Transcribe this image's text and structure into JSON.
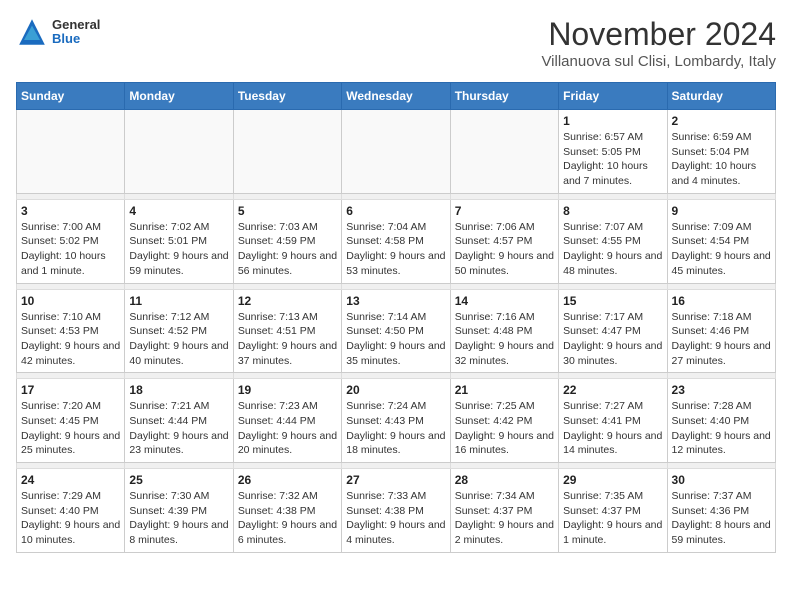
{
  "header": {
    "logo_general": "General",
    "logo_blue": "Blue",
    "month_title": "November 2024",
    "location": "Villanuova sul Clisi, Lombardy, Italy"
  },
  "days_of_week": [
    "Sunday",
    "Monday",
    "Tuesday",
    "Wednesday",
    "Thursday",
    "Friday",
    "Saturday"
  ],
  "weeks": [
    [
      {
        "day": "",
        "info": ""
      },
      {
        "day": "",
        "info": ""
      },
      {
        "day": "",
        "info": ""
      },
      {
        "day": "",
        "info": ""
      },
      {
        "day": "",
        "info": ""
      },
      {
        "day": "1",
        "info": "Sunrise: 6:57 AM\nSunset: 5:05 PM\nDaylight: 10 hours and 7 minutes."
      },
      {
        "day": "2",
        "info": "Sunrise: 6:59 AM\nSunset: 5:04 PM\nDaylight: 10 hours and 4 minutes."
      }
    ],
    [
      {
        "day": "3",
        "info": "Sunrise: 7:00 AM\nSunset: 5:02 PM\nDaylight: 10 hours and 1 minute."
      },
      {
        "day": "4",
        "info": "Sunrise: 7:02 AM\nSunset: 5:01 PM\nDaylight: 9 hours and 59 minutes."
      },
      {
        "day": "5",
        "info": "Sunrise: 7:03 AM\nSunset: 4:59 PM\nDaylight: 9 hours and 56 minutes."
      },
      {
        "day": "6",
        "info": "Sunrise: 7:04 AM\nSunset: 4:58 PM\nDaylight: 9 hours and 53 minutes."
      },
      {
        "day": "7",
        "info": "Sunrise: 7:06 AM\nSunset: 4:57 PM\nDaylight: 9 hours and 50 minutes."
      },
      {
        "day": "8",
        "info": "Sunrise: 7:07 AM\nSunset: 4:55 PM\nDaylight: 9 hours and 48 minutes."
      },
      {
        "day": "9",
        "info": "Sunrise: 7:09 AM\nSunset: 4:54 PM\nDaylight: 9 hours and 45 minutes."
      }
    ],
    [
      {
        "day": "10",
        "info": "Sunrise: 7:10 AM\nSunset: 4:53 PM\nDaylight: 9 hours and 42 minutes."
      },
      {
        "day": "11",
        "info": "Sunrise: 7:12 AM\nSunset: 4:52 PM\nDaylight: 9 hours and 40 minutes."
      },
      {
        "day": "12",
        "info": "Sunrise: 7:13 AM\nSunset: 4:51 PM\nDaylight: 9 hours and 37 minutes."
      },
      {
        "day": "13",
        "info": "Sunrise: 7:14 AM\nSunset: 4:50 PM\nDaylight: 9 hours and 35 minutes."
      },
      {
        "day": "14",
        "info": "Sunrise: 7:16 AM\nSunset: 4:48 PM\nDaylight: 9 hours and 32 minutes."
      },
      {
        "day": "15",
        "info": "Sunrise: 7:17 AM\nSunset: 4:47 PM\nDaylight: 9 hours and 30 minutes."
      },
      {
        "day": "16",
        "info": "Sunrise: 7:18 AM\nSunset: 4:46 PM\nDaylight: 9 hours and 27 minutes."
      }
    ],
    [
      {
        "day": "17",
        "info": "Sunrise: 7:20 AM\nSunset: 4:45 PM\nDaylight: 9 hours and 25 minutes."
      },
      {
        "day": "18",
        "info": "Sunrise: 7:21 AM\nSunset: 4:44 PM\nDaylight: 9 hours and 23 minutes."
      },
      {
        "day": "19",
        "info": "Sunrise: 7:23 AM\nSunset: 4:44 PM\nDaylight: 9 hours and 20 minutes."
      },
      {
        "day": "20",
        "info": "Sunrise: 7:24 AM\nSunset: 4:43 PM\nDaylight: 9 hours and 18 minutes."
      },
      {
        "day": "21",
        "info": "Sunrise: 7:25 AM\nSunset: 4:42 PM\nDaylight: 9 hours and 16 minutes."
      },
      {
        "day": "22",
        "info": "Sunrise: 7:27 AM\nSunset: 4:41 PM\nDaylight: 9 hours and 14 minutes."
      },
      {
        "day": "23",
        "info": "Sunrise: 7:28 AM\nSunset: 4:40 PM\nDaylight: 9 hours and 12 minutes."
      }
    ],
    [
      {
        "day": "24",
        "info": "Sunrise: 7:29 AM\nSunset: 4:40 PM\nDaylight: 9 hours and 10 minutes."
      },
      {
        "day": "25",
        "info": "Sunrise: 7:30 AM\nSunset: 4:39 PM\nDaylight: 9 hours and 8 minutes."
      },
      {
        "day": "26",
        "info": "Sunrise: 7:32 AM\nSunset: 4:38 PM\nDaylight: 9 hours and 6 minutes."
      },
      {
        "day": "27",
        "info": "Sunrise: 7:33 AM\nSunset: 4:38 PM\nDaylight: 9 hours and 4 minutes."
      },
      {
        "day": "28",
        "info": "Sunrise: 7:34 AM\nSunset: 4:37 PM\nDaylight: 9 hours and 2 minutes."
      },
      {
        "day": "29",
        "info": "Sunrise: 7:35 AM\nSunset: 4:37 PM\nDaylight: 9 hours and 1 minute."
      },
      {
        "day": "30",
        "info": "Sunrise: 7:37 AM\nSunset: 4:36 PM\nDaylight: 8 hours and 59 minutes."
      }
    ]
  ]
}
